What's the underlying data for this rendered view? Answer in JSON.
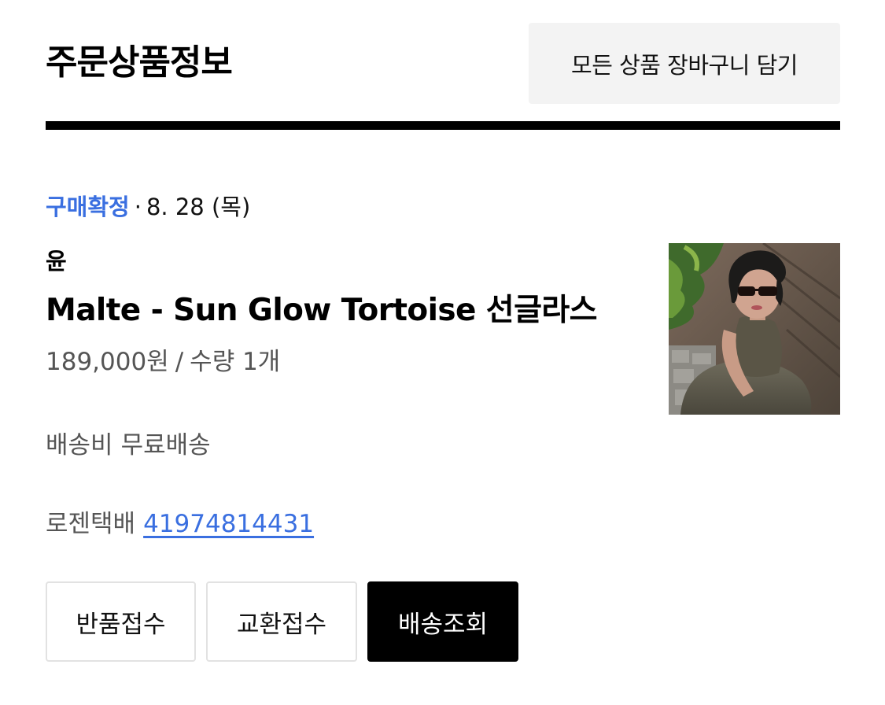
{
  "header": {
    "title": "주문상품정보",
    "add_all_to_cart_label": "모든 상품 장바구니 담기"
  },
  "order_item": {
    "status": "구매확정",
    "status_separator": "·",
    "date": "8. 28 (목)",
    "brand": "윤",
    "product_name": "Malte - Sun Glow Tortoise 선글라스",
    "price": "189,000원",
    "price_qty_separator": "/",
    "quantity": "수량 1개",
    "thumbnail_icon": "product-photo-sunglasses-model",
    "shipping_fee_label": "배송비",
    "shipping_fee_value": "무료배송",
    "courier": "로젠택배",
    "tracking_number": "41974814431"
  },
  "actions": {
    "return_label": "반품접수",
    "exchange_label": "교환접수",
    "track_label": "배송조회"
  },
  "colors": {
    "accent_blue": "#3a6fe0",
    "primary_button": "#000000",
    "secondary_bg": "#f3f3f3"
  }
}
